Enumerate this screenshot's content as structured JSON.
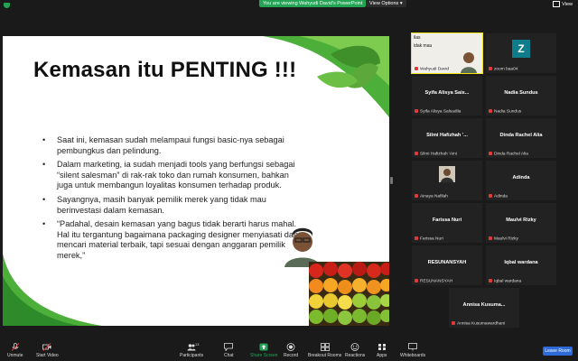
{
  "topbar": {
    "viewing_banner": "You are viewing Wahyudi David's PowerPoint",
    "view_options": "View Options",
    "view_label": "View"
  },
  "slide": {
    "title": "Kemasan itu PENTING !!!",
    "bullets": [
      "Saat ini, kemasan sudah melampaui fungsi basic-nya sebagai pembungkus dan pelindung.",
      "Dalam marketing, ia sudah menjadi tools yang berfungsi sebagai “silent salesman” di rak-rak toko dan rumah konsumen, bahkan juga untuk membangun loyalitas konsumen terhadap produk.",
      "Sayangnya, masih banyak pemilik merek yang tidak mau berinvestasi dalam kemasan.",
      "“Padahal, desain kemasan yang bagus tidak berarti harus mahal. Hal itu tergantung bagaimana packaging designer menyiasati dan mencari material terbaik, tapi sesuai dengan anggaran pemilik merek,”"
    ]
  },
  "participants": {
    "speaker_tile": {
      "text_lines": [
        "ilas",
        "idak mau"
      ],
      "name": "Wahyudi David"
    },
    "tiles": [
      {
        "id": "zoom",
        "name": "",
        "sub": "zoom baa04",
        "avatar_letter": "Z",
        "avatar_color": "#0e7c8a"
      },
      {
        "id": "syifa",
        "name": "Syifa Alisya Sais...",
        "sub": "Syifa Alisya Salsadila"
      },
      {
        "id": "nadia",
        "name": "Nadia Sundus",
        "sub": "Nadia Sundus"
      },
      {
        "id": "silmi",
        "name": "Silmi Hafizhah '...",
        "sub": "Silmi Hafizhah 'Aini"
      },
      {
        "id": "dinda",
        "name": "Dinda Rachel Alia",
        "sub": "Dinda Rachel Alia"
      },
      {
        "id": "ainaya",
        "name": "",
        "sub": "Ainaya Nafilah"
      },
      {
        "id": "adinda",
        "name": "Adinda",
        "sub": "Adinda"
      },
      {
        "id": "farissa",
        "name": "Farissa Nuri",
        "sub": "Farissa Nuri"
      },
      {
        "id": "maulvi",
        "name": "Maulvi Rizky",
        "sub": "Maulvi Rizky"
      },
      {
        "id": "resu",
        "name": "RESUNANSYAH",
        "sub": "RESUNANSYAH"
      },
      {
        "id": "iqbal",
        "name": "Iqbal wardana",
        "sub": "Iqbal wardana"
      },
      {
        "id": "annisa",
        "name": "Annisa Kusuma...",
        "sub": "Annisa Kusumawardhani"
      }
    ]
  },
  "toolbar": {
    "unmute": "Unmute",
    "start_video": "Start Video",
    "participants": "Participants",
    "participants_count": "13",
    "chat": "Chat",
    "share_screen": "Share Screen",
    "record": "Record",
    "breakout": "Breakout Rooms",
    "reactions": "Reactions",
    "apps": "Apps",
    "whiteboards": "Whiteboards",
    "leave": "Leave Room"
  },
  "colors": {
    "share_green": "#23a454",
    "leave_blue": "#2d6bd8",
    "active_speaker": "#f2e11a",
    "slide_accent_green": "#4caf3a"
  }
}
